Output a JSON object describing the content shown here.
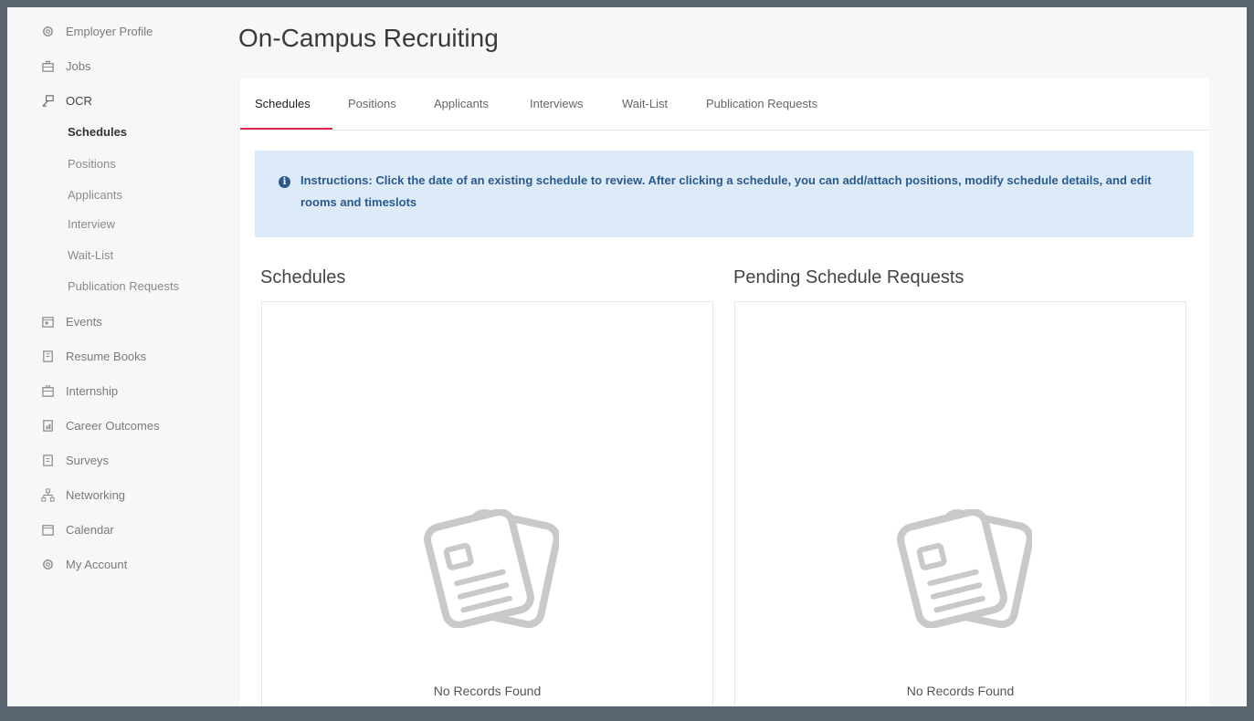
{
  "sidebar": {
    "items": [
      {
        "label": "Employer Profile",
        "icon": "gear-icon"
      },
      {
        "label": "Jobs",
        "icon": "briefcase-icon"
      },
      {
        "label": "OCR",
        "icon": "ocr-icon"
      },
      {
        "label": "Events",
        "icon": "calendar-event-icon"
      },
      {
        "label": "Resume Books",
        "icon": "book-icon"
      },
      {
        "label": "Internship",
        "icon": "internship-icon"
      },
      {
        "label": "Career Outcomes",
        "icon": "report-icon"
      },
      {
        "label": "Surveys",
        "icon": "survey-icon"
      },
      {
        "label": "Networking",
        "icon": "network-icon"
      },
      {
        "label": "Calendar",
        "icon": "calendar-icon"
      },
      {
        "label": "My Account",
        "icon": "account-gear-icon"
      }
    ],
    "ocr_subitems": [
      "Schedules",
      "Positions",
      "Applicants",
      "Interview",
      "Wait-List",
      "Publication Requests"
    ]
  },
  "header": {
    "title": "On-Campus Recruiting"
  },
  "tabs": [
    "Schedules",
    "Positions",
    "Applicants",
    "Interviews",
    "Wait-List",
    "Publication Requests"
  ],
  "active_tab": "Schedules",
  "alert": {
    "icon": "info-icon",
    "text": "Instructions: Click the date of an existing schedule to review. After clicking a schedule, you can add/attach positions, modify schedule details, and edit rooms and timeslots"
  },
  "schedules": {
    "title": "Schedules",
    "empty_text": "No Records Found",
    "empty_icon": "documents-icon"
  },
  "pending": {
    "title": "Pending Schedule Requests",
    "empty_text": "No Records Found",
    "empty_icon": "documents-icon"
  },
  "colors": {
    "accent": "#e0284f",
    "alert_bg": "#ddebf9",
    "alert_text": "#2a5a8c"
  }
}
